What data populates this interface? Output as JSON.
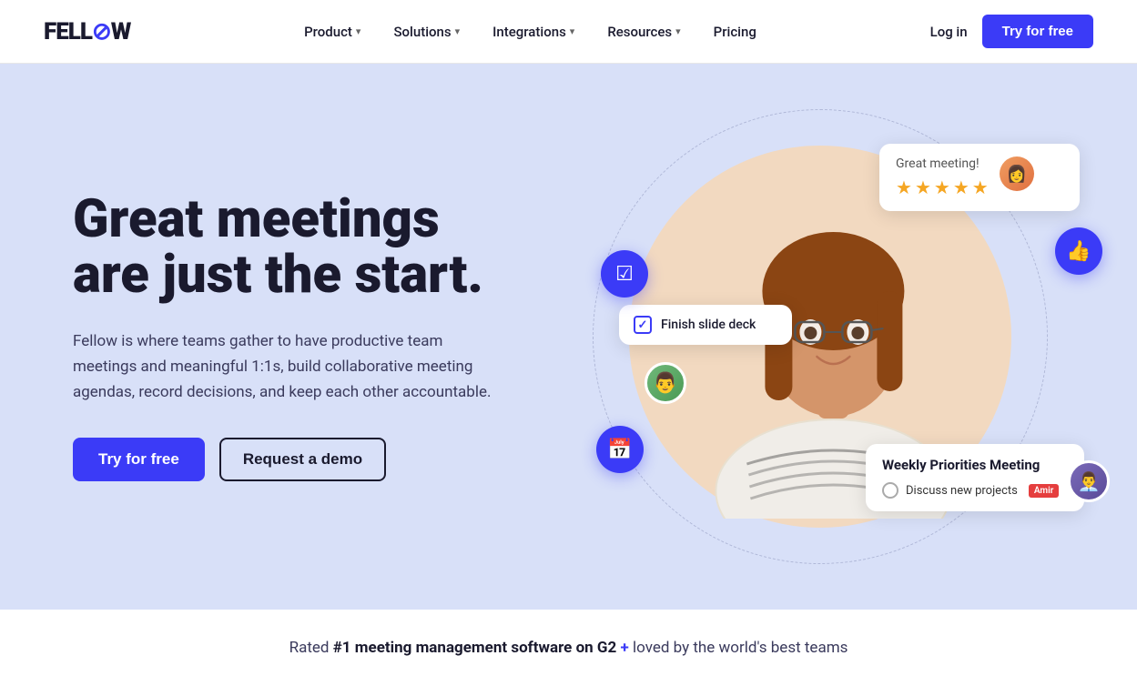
{
  "brand": {
    "name_prefix": "FELL",
    "name_slash": "⌀",
    "name_suffix": "W"
  },
  "nav": {
    "links": [
      {
        "id": "product",
        "label": "Product",
        "has_dropdown": true
      },
      {
        "id": "solutions",
        "label": "Solutions",
        "has_dropdown": true
      },
      {
        "id": "integrations",
        "label": "Integrations",
        "has_dropdown": true
      },
      {
        "id": "resources",
        "label": "Resources",
        "has_dropdown": true
      },
      {
        "id": "pricing",
        "label": "Pricing",
        "has_dropdown": false
      }
    ],
    "login_label": "Log in",
    "cta_label": "Try for free"
  },
  "hero": {
    "title_line1": "Great meetings",
    "title_line2": "are just the start.",
    "description": "Fellow is where teams gather to have productive team meetings and meaningful 1:1s, build collaborative meeting agendas, record decisions, and keep each other accountable.",
    "btn_primary": "Try for free",
    "btn_secondary": "Request a demo"
  },
  "ui_bubbles": {
    "rating": {
      "title": "Great meeting!",
      "stars": 5
    },
    "task": {
      "label": "Finish slide deck",
      "checked": true
    },
    "meeting": {
      "title": "Weekly Priorities Meeting",
      "item": "Discuss new projects",
      "tag": "Amir"
    }
  },
  "bottom": {
    "text": "Rated #1 meeting management software on G2 + loved by the world's best teams",
    "highlight_plus": "+"
  }
}
